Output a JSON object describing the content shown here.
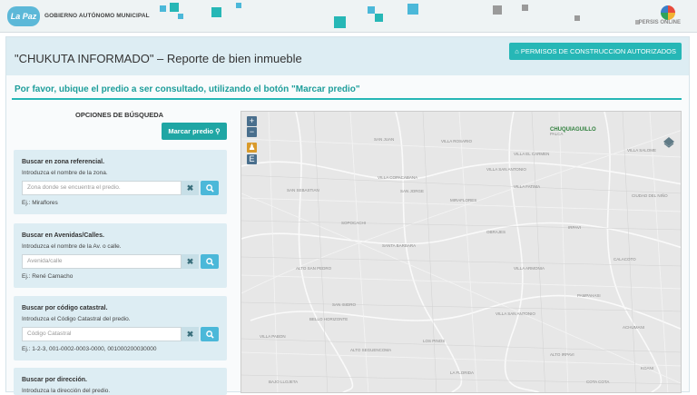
{
  "topbar": {
    "logo_text": "La Paz",
    "org_name": "GOBIERNO AUTÓNOMO MUNICIPAL",
    "brand_right": "PERSIS ONLINE",
    "colors": {
      "teal": "#26b7b6",
      "cyan": "#4bb8d9",
      "gray": "#9a9a9a"
    }
  },
  "header": {
    "title": "\"CHUKUTA INFORMADO\" – Reporte de bien inmueble",
    "permisos_button": "PERMISOS DE CONSTRUCCION AUTORIZADOS",
    "home_icon": "home-icon"
  },
  "instruction": "Por favor, ubique el predio a ser consultado, utilizando el botón \"Marcar predio\"",
  "options": {
    "title": "OPCIONES DE BÚSQUEDA",
    "marcar_button": "Marcar predio",
    "marcar_icon": "map-marker-icon"
  },
  "cards": [
    {
      "title": "Buscar en zona referencial.",
      "sub": "Introduzca el nombre de la zona.",
      "placeholder": "Zona donde se encuentra el predio.",
      "example": "Ej.: Miraflores"
    },
    {
      "title": "Buscar en Avenidas/Calles.",
      "sub": "Introduzca el nombre de la Av. o calle.",
      "placeholder": "Avenida/calle",
      "example": "Ej.: René Camacho"
    },
    {
      "title": "Buscar por código catastral.",
      "sub": "Introduzca el Código Catastral del predio.",
      "placeholder": "Código Catastral",
      "example": "Ej.: 1-2-3, 001-0002-0003-0000, 001000200030000"
    },
    {
      "title": "Buscar por dirección.",
      "sub": "Introduzca la dirección del predio.",
      "placeholder": "",
      "example": ""
    }
  ],
  "map": {
    "zoom_in": "+",
    "zoom_out": "−",
    "extra_btn": "E",
    "highlight_place": "CHUQUIAGUILLO",
    "places": [
      "PALCA",
      "VILLA ROSARIO",
      "VILLA SALOME",
      "SAN JUAN",
      "VILLA EL CARMEN",
      "VILLA SAN ANTONIO",
      "VILLA COPACABANA",
      "SAN SEBASTIAN",
      "CIUDAD DEL NIÑO",
      "VILLA FATIMA",
      "MIRAFLORES",
      "SAN JORGE",
      "SOPOCACHI",
      "SANTA BARBARA",
      "IRPAVI",
      "OBRAJES",
      "CALACOTO",
      "VILLA ARMONIA",
      "ALTO SAN PEDRO",
      "PAMPAHASI",
      "VILLA SAN ANTONIO",
      "ACHUMANI",
      "SAN ISIDRO",
      "BELLO HORIZONTE",
      "VILLA PABON",
      "ALTO SEGUENCOMA",
      "LOS PINOS",
      "ALTO IRPAVI",
      "KOANI",
      "LA FLORIDA",
      "COTA COTA",
      "BAJO LLOJETA"
    ]
  }
}
